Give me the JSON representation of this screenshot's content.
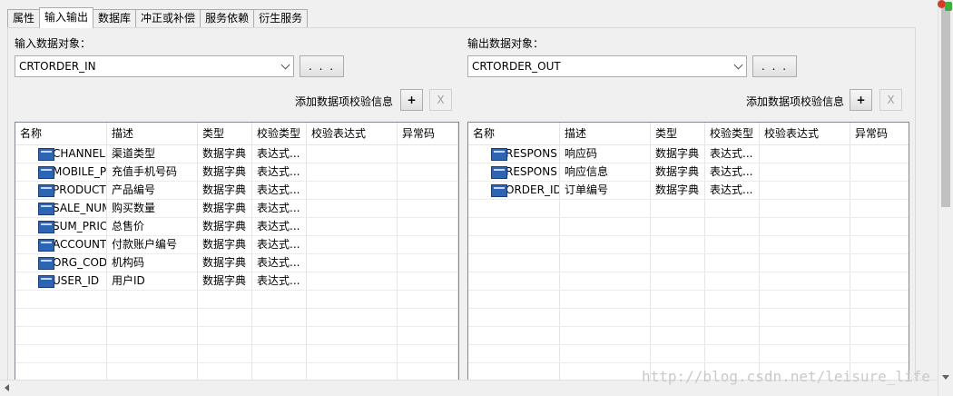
{
  "tabs": [
    {
      "label": "属性",
      "active": false
    },
    {
      "label": "输入输出",
      "active": true
    },
    {
      "label": "数据库",
      "active": false
    },
    {
      "label": "冲正或补偿",
      "active": false
    },
    {
      "label": "服务依赖",
      "active": false
    },
    {
      "label": "衍生服务",
      "active": false
    }
  ],
  "columns": [
    "名称",
    "描述",
    "类型",
    "校验类型",
    "校验表达式",
    "异常码"
  ],
  "input": {
    "label": "输入数据对象：",
    "selected": "CRTORDER_IN",
    "browse_label": ". . .",
    "add_validation_label": "添加数据项校验信息",
    "add_button": "+",
    "remove_button": "X",
    "rows": [
      {
        "name": "CHANNEL",
        "desc": "渠道类型",
        "type": "数据字典",
        "check": "表达式..."
      },
      {
        "name": "MOBILE_P",
        "desc": "充值手机号码",
        "type": "数据字典",
        "check": "表达式..."
      },
      {
        "name": "PRODUCT",
        "desc": "产品编号",
        "type": "数据字典",
        "check": "表达式..."
      },
      {
        "name": "SALE_NUM",
        "desc": "购买数量",
        "type": "数据字典",
        "check": "表达式..."
      },
      {
        "name": "SUM_PRIC",
        "desc": "总售价",
        "type": "数据字典",
        "check": "表达式..."
      },
      {
        "name": "ACCOUNT",
        "desc": "付款账户编号",
        "type": "数据字典",
        "check": "表达式..."
      },
      {
        "name": "ORG_COD",
        "desc": "机构码",
        "type": "数据字典",
        "check": "表达式..."
      },
      {
        "name": "USER_ID",
        "desc": "用户ID",
        "type": "数据字典",
        "check": "表达式..."
      }
    ]
  },
  "output": {
    "label": "输出数据对象：",
    "selected": "CRTORDER_OUT",
    "browse_label": ". . .",
    "add_validation_label": "添加数据项校验信息",
    "add_button": "+",
    "remove_button": "X",
    "rows": [
      {
        "name": "RESPONS",
        "desc": "响应码",
        "type": "数据字典",
        "check": "表达式..."
      },
      {
        "name": "RESPONS",
        "desc": "响应信息",
        "type": "数据字典",
        "check": "表达式..."
      },
      {
        "name": "ORDER_ID",
        "desc": "订单编号",
        "type": "数据字典",
        "check": "表达式..."
      }
    ]
  },
  "watermark": "http://blog.csdn.net/leisure_life",
  "icon_names": [
    "field-icon",
    "dropdown-arrow-icon",
    "scroll-down-icon",
    "scroll-left-icon"
  ]
}
